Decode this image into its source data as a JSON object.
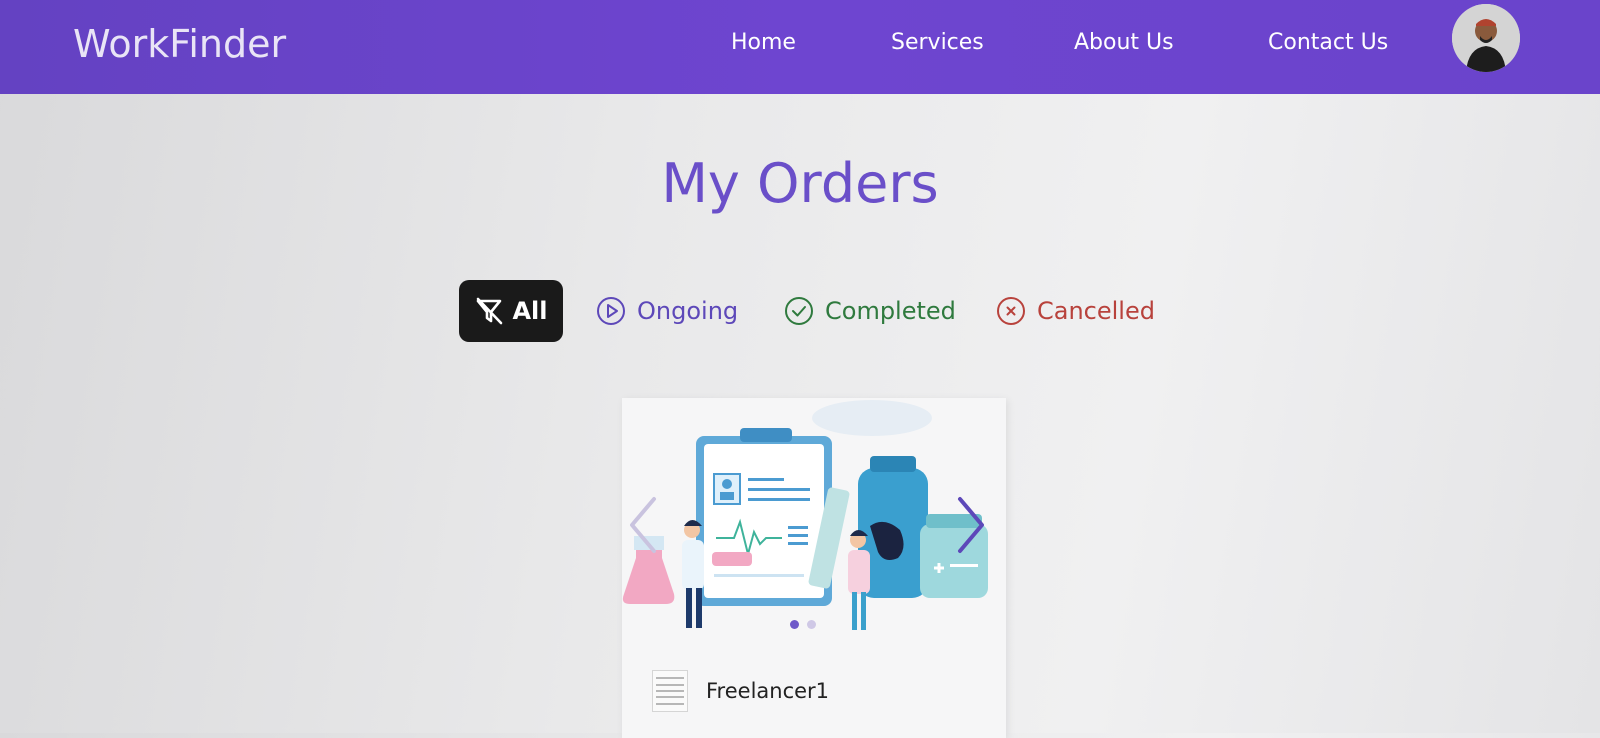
{
  "navbar": {
    "brand": "WorkFinder",
    "links": [
      "Home",
      "Services",
      "About Us",
      "Contact Us"
    ]
  },
  "page": {
    "title": "My Orders"
  },
  "filters": {
    "all": "All",
    "ongoing": "Ongoing",
    "completed": "Completed",
    "cancelled": "Cancelled"
  },
  "order_card": {
    "freelancer": "Freelancer1",
    "carousel_dots": 2,
    "active_dot": 1
  },
  "colors": {
    "accent": "#6a44cb",
    "ongoing": "#5d48b9",
    "completed": "#2f7a3e",
    "cancelled": "#b8423c"
  }
}
